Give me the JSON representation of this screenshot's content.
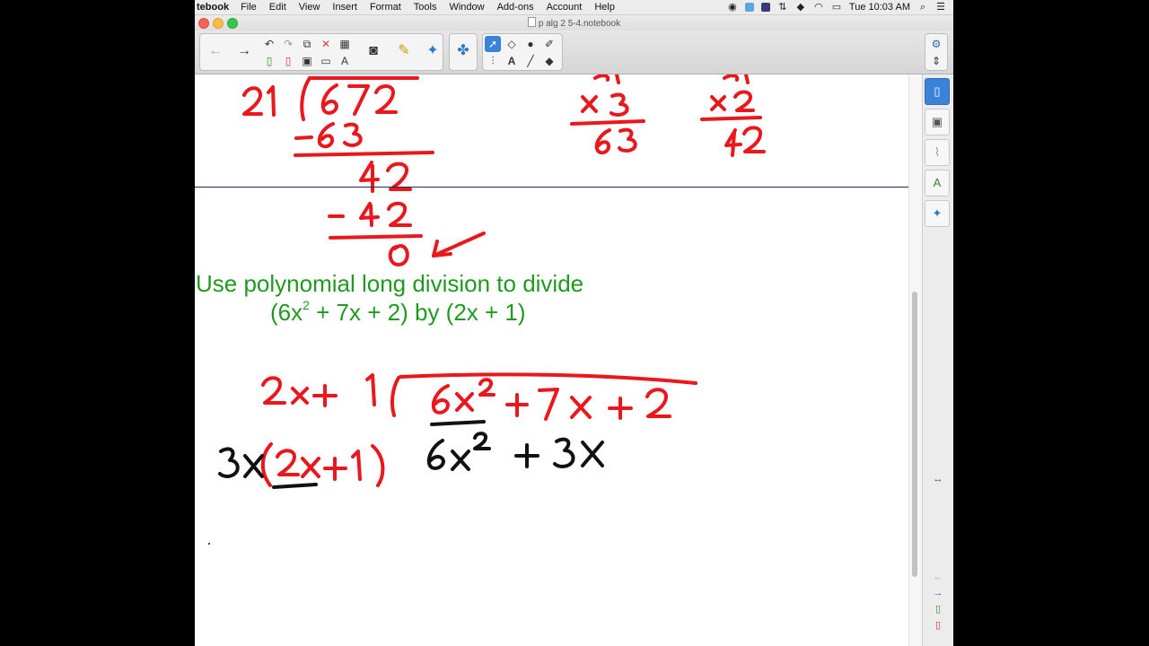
{
  "menubar": {
    "app_name": "tebook",
    "items": [
      "File",
      "Edit",
      "View",
      "Insert",
      "Format",
      "Tools",
      "Window",
      "Add-ons",
      "Account",
      "Help"
    ],
    "clock": "Tue 10:03 AM"
  },
  "window": {
    "title": "p alg 2 5-4.notebook"
  },
  "content": {
    "heading_line1": "Use polynomial long division to divide",
    "heading_line2_pre": "(6x",
    "heading_line2_sup": "2",
    "heading_line2_post": " + 7x + 2) by (2x + 1)"
  },
  "colors": {
    "ink_red": "#e8181c",
    "ink_black": "#111111",
    "heading_green": "#1f9a1f",
    "accent_blue": "#3a83d8"
  },
  "icons": {
    "back": "←",
    "forward": "→",
    "undo": "↶",
    "redo": "↷",
    "delete": "✕",
    "settings": "⚙"
  }
}
